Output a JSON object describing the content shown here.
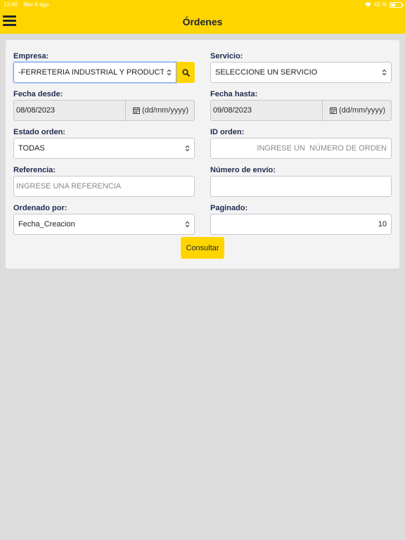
{
  "status_bar": {
    "time": "12:46",
    "date": "Mar 8 ago.",
    "battery": "42 %",
    "battery_level": 0.42
  },
  "header": {
    "title": "Órdenes",
    "menu_icon": "hamburger-menu-icon"
  },
  "form": {
    "empresa": {
      "label": "Empresa:",
      "value": "-FERRETERIA INDUSTRIAL Y PRODUCTOS"
    },
    "servicio": {
      "label": "Servicio:",
      "value": "SELECCIONE UN SERVICIO"
    },
    "fecha_desde": {
      "label": "Fecha desde:",
      "value": "08/08/2023",
      "format": "(dd/mm/yyyy)"
    },
    "fecha_hasta": {
      "label": "Fecha hasta:",
      "value": "09/08/2023",
      "format": "(dd/mm/yyyy)"
    },
    "estado_orden": {
      "label": "Estado orden:",
      "value": "TODAS"
    },
    "id_orden": {
      "label": "ID orden:",
      "placeholder": "INGRESE UN  NÚMERO DE ORDEN"
    },
    "referencia": {
      "label": "Referencia:",
      "placeholder": "INGRESE UNA REFERENCIA"
    },
    "numero_envio": {
      "label": "Número de envío:",
      "value": ""
    },
    "ordenado_por": {
      "label": "Ordenado por:",
      "value": "Fecha_Creacion"
    },
    "paginado": {
      "label": "Paginado:",
      "value": "10"
    },
    "submit_label": "Consultar"
  },
  "colors": {
    "accent": "#ffd500",
    "label": "#1e2b4d",
    "background": "#dcdcdd",
    "card": "#f4f3f4"
  }
}
